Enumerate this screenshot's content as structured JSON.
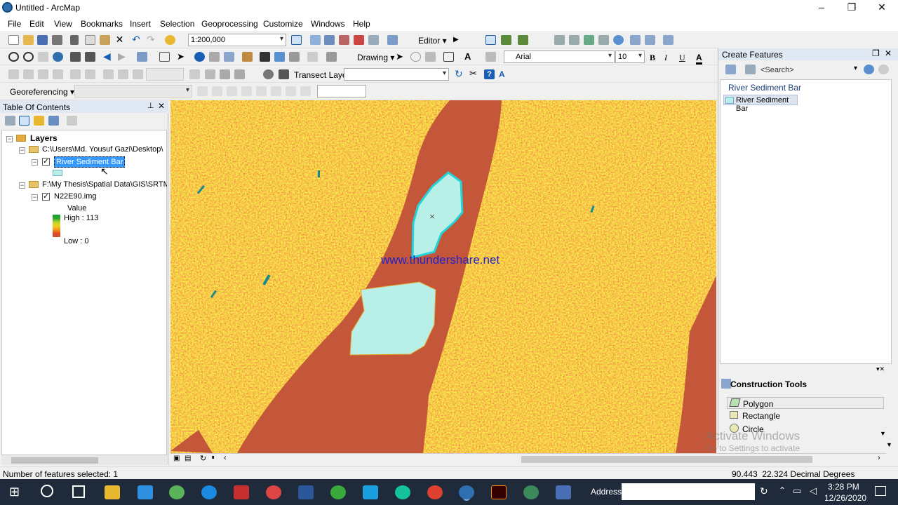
{
  "window": {
    "title": "Untitled - ArcMap",
    "min": "–",
    "max": "❐",
    "close": "✕"
  },
  "menu": [
    "File",
    "Edit",
    "View",
    "Bookmarks",
    "Insert",
    "Selection",
    "Geoprocessing",
    "Customize",
    "Windows",
    "Help"
  ],
  "toolbar": {
    "scale": "1:200,000",
    "editor_label": "Editor ▾",
    "drawing_label": "Drawing ▾",
    "font_name": "Arial",
    "font_size": "10",
    "bold": "B",
    "italic": "I",
    "underline": "U",
    "font_color_glyph": "A",
    "transect_label": "Transect Layer",
    "georef_label": "Georeferencing ▾"
  },
  "toc": {
    "title": "Table Of Contents",
    "layers_label": "Layers",
    "path1": "C:\\Users\\Md. Yousuf Gazi\\Desktop\\",
    "layer1": "River Sediment Bar",
    "path2": "F:\\My Thesis\\Spatial Data\\GIS\\SRTM",
    "layer2": "N22E90.img",
    "value_label": "Value",
    "high_label": "High : 113",
    "low_label": "Low : 0"
  },
  "map": {
    "watermark": "www.thundershare.net"
  },
  "create_features": {
    "title": "Create Features",
    "search_placeholder": "<Search>",
    "group_label": "River Sediment Bar",
    "template_label": "River Sediment Bar",
    "construction_title": "Construction Tools",
    "tools": [
      "Polygon",
      "Rectangle",
      "Circle"
    ]
  },
  "activate": {
    "line1": "Activate Windows",
    "line2": "Go to Settings to activate"
  },
  "status": {
    "selected": "Number of features selected: 1",
    "coords": "90.443  22.324 Decimal Degrees"
  },
  "taskbar": {
    "address_label": "Address",
    "time": "3:28 PM",
    "date": "12/26/2020"
  },
  "colors": {
    "river": "#c4573a",
    "sediment": "#b8f0e8",
    "sediment_outline": "#22d4d8",
    "terrain": "#e8a02a",
    "selection": "#3399ff"
  }
}
